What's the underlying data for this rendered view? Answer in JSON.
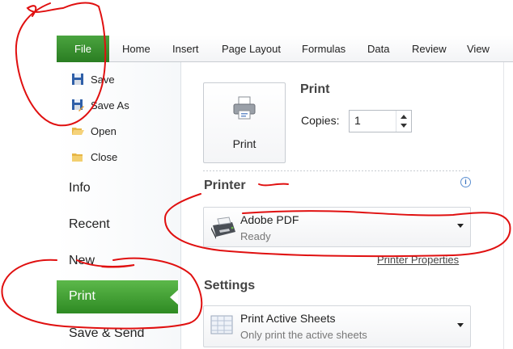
{
  "ribbon": {
    "file_tab": "File",
    "tabs": [
      "Home",
      "Insert",
      "Page Layout",
      "Formulas",
      "Data",
      "Review",
      "View"
    ]
  },
  "backstage": {
    "commands": [
      {
        "label": "Save",
        "icon": "save-icon"
      },
      {
        "label": "Save As",
        "icon": "save-as-icon"
      },
      {
        "label": "Open",
        "icon": "folder-open-icon"
      },
      {
        "label": "Close",
        "icon": "folder-close-icon"
      }
    ],
    "sections": [
      "Info",
      "Recent",
      "New",
      "Print",
      "Save & Send"
    ],
    "selected": "Print"
  },
  "print": {
    "heading": "Print",
    "button_label": "Print",
    "copies_label": "Copies:",
    "copies_value": "1"
  },
  "printer": {
    "heading": "Printer",
    "name": "Adobe PDF",
    "status": "Ready",
    "properties_link": "Printer Properties"
  },
  "settings": {
    "heading": "Settings",
    "option_title": "Print Active Sheets",
    "option_desc": "Only print the active sheets"
  },
  "colors": {
    "accent_green": "#2e8a23",
    "annotation_red": "#e01010"
  }
}
